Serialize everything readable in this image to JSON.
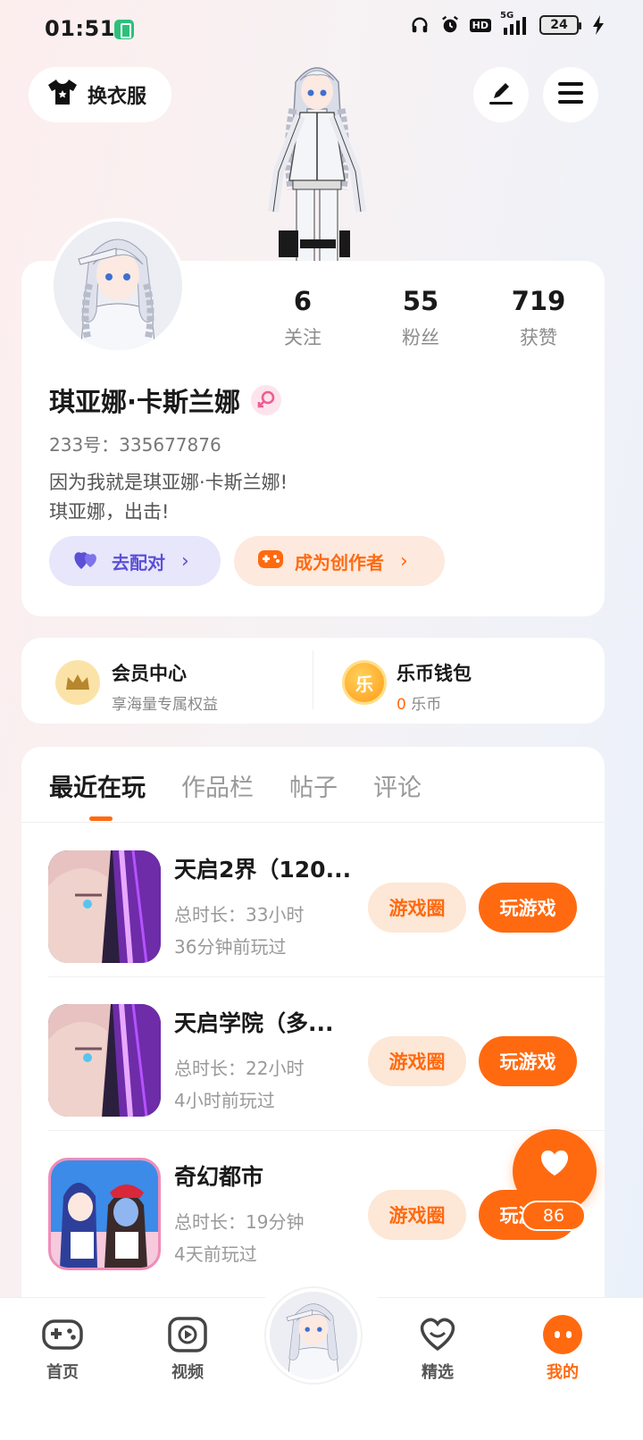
{
  "status_bar": {
    "time": "01:51",
    "network": "5G",
    "battery": "24",
    "hd_label": "HD"
  },
  "header": {
    "outfit_label": "换衣服",
    "icons": [
      "tshirt-icon",
      "edit-icon",
      "menu-icon"
    ]
  },
  "profile": {
    "stats": [
      {
        "value": "6",
        "label": "关注"
      },
      {
        "value": "55",
        "label": "粉丝"
      },
      {
        "value": "719",
        "label": "获赞"
      }
    ],
    "nickname": "琪亚娜·卡斯兰娜",
    "gender": "female",
    "uid": "233号：335677876",
    "bio": "因为我就是琪亚娜·卡斯兰娜!\n琪亚娜，出击!",
    "match_label": "去配对",
    "creator_label": "成为创作者"
  },
  "wallet": {
    "vip_title": "会员中心",
    "vip_sub": "享海量专属权益",
    "coin_title": "乐币钱包",
    "coin_icon_text": "乐",
    "coin_amount": "0",
    "coin_unit": "乐币"
  },
  "tabs": [
    "最近在玩",
    "作品栏",
    "帖子",
    "评论"
  ],
  "games": [
    {
      "title": "天启2界（120...",
      "duration": "总时长：33小时",
      "last_played": "36分钟前玩过",
      "circle_label": "游戏圈",
      "play_label": "玩游戏"
    },
    {
      "title": "天启学院（多...",
      "duration": "总时长：22小时",
      "last_played": "4小时前玩过",
      "circle_label": "游戏圈",
      "play_label": "玩游戏"
    },
    {
      "title": "奇幻都市",
      "duration": "总时长：19分钟",
      "last_played": "4天前玩过",
      "circle_label": "游戏圈",
      "play_label": "玩游戏"
    }
  ],
  "like_fab": {
    "count": "86"
  },
  "bottom_nav": [
    {
      "label": "首页"
    },
    {
      "label": "视频"
    },
    {
      "label": "精选"
    },
    {
      "label": "我的"
    }
  ],
  "colors": {
    "accent": "#ff6a10",
    "match": "#5b50d6"
  }
}
